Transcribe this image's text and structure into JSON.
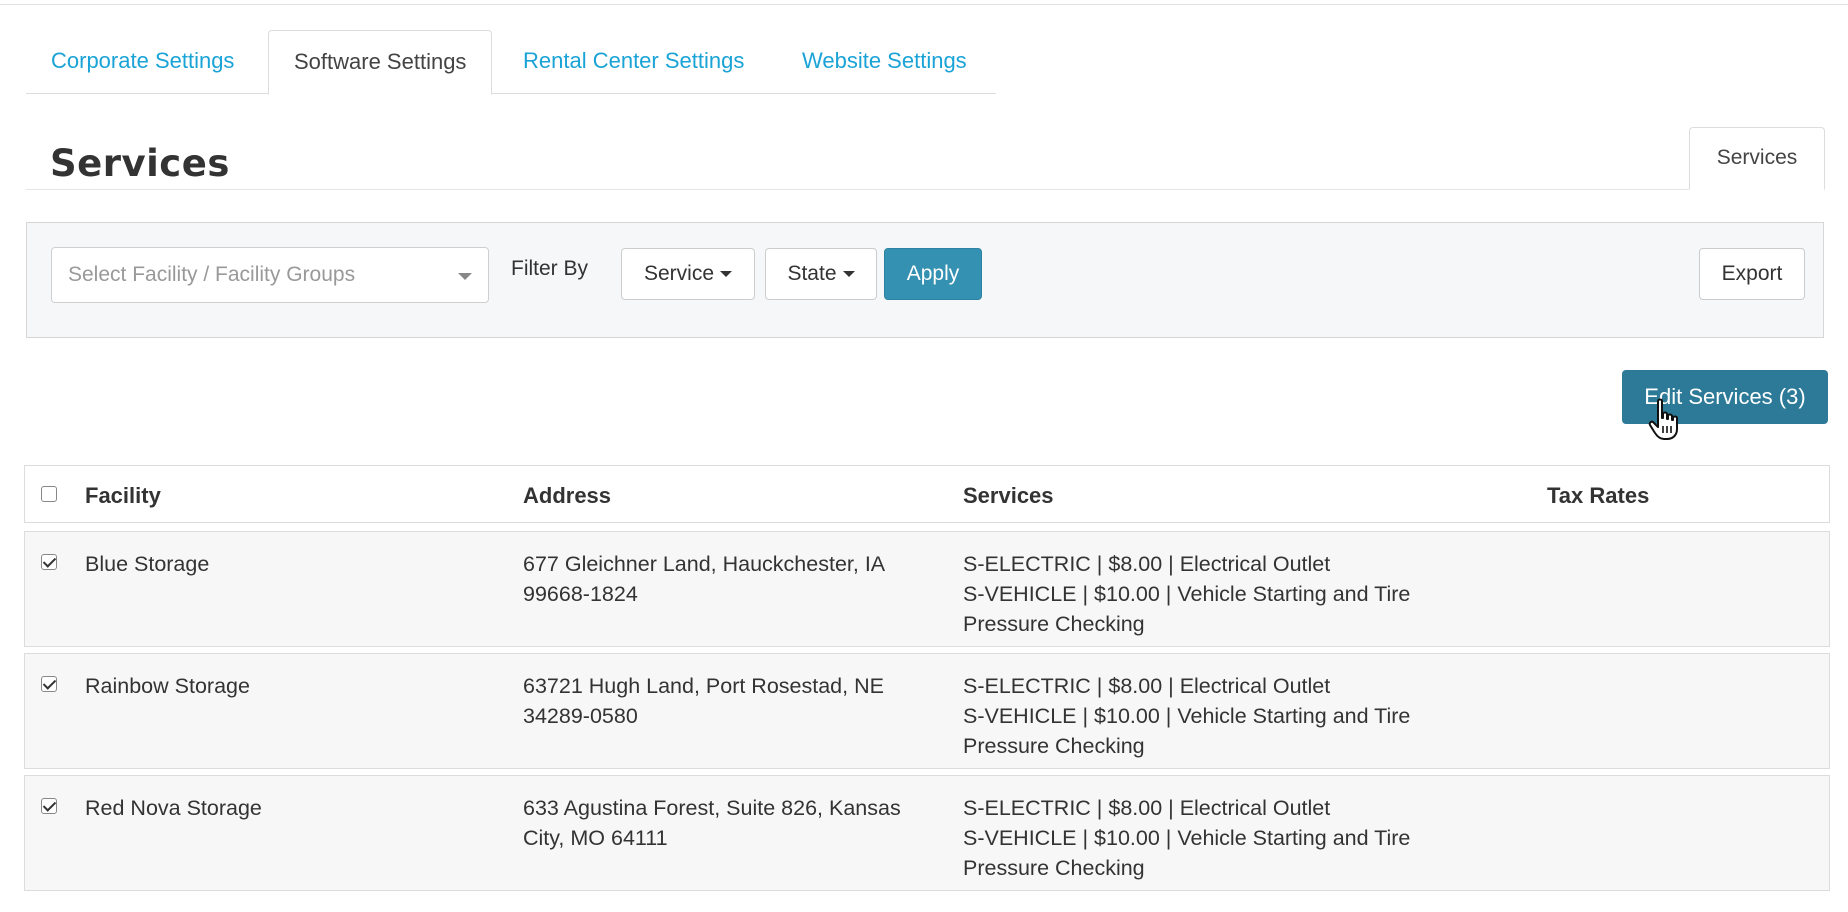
{
  "tabs": [
    {
      "label": "Corporate Settings",
      "active": false
    },
    {
      "label": "Software Settings",
      "active": true
    },
    {
      "label": "Rental Center Settings",
      "active": false
    },
    {
      "label": "Website Settings",
      "active": false
    }
  ],
  "section": {
    "title": "Services",
    "subtab_label": "Services"
  },
  "filters": {
    "facility_placeholder": "Select Facility / Facility Groups",
    "filter_by_label": "Filter By",
    "service_dropdown": "Service",
    "state_dropdown": "State",
    "apply_label": "Apply",
    "export_label": "Export"
  },
  "edit_services_label": "Edit Services (3)",
  "table": {
    "headers": {
      "facility": "Facility",
      "address": "Address",
      "services": "Services",
      "tax_rates": "Tax Rates"
    },
    "header_checked": false,
    "rows": [
      {
        "checked": true,
        "facility": "Blue Storage",
        "address_line1": "677 Gleichner Land, Hauckchester, IA",
        "address_line2": "99668-1824",
        "service_line1": "S-ELECTRIC | $8.00 | Electrical Outlet",
        "service_line2": "S-VEHICLE | $10.00 | Vehicle Starting and Tire",
        "service_line3": "Pressure Checking",
        "tax_rates": ""
      },
      {
        "checked": true,
        "facility": "Rainbow Storage",
        "address_line1": "63721 Hugh Land, Port Rosestad, NE",
        "address_line2": "34289-0580",
        "service_line1": "S-ELECTRIC | $8.00 | Electrical Outlet",
        "service_line2": "S-VEHICLE | $10.00 | Vehicle Starting and Tire",
        "service_line3": "Pressure Checking",
        "tax_rates": ""
      },
      {
        "checked": true,
        "facility": "Red Nova Storage",
        "address_line1": "633 Agustina Forest, Suite 826, Kansas",
        "address_line2": "City, MO 64111",
        "service_line1": "S-ELECTRIC | $8.00 | Electrical Outlet",
        "service_line2": "S-VEHICLE | $10.00 | Vehicle Starting and Tire",
        "service_line3": "Pressure Checking",
        "tax_rates": ""
      }
    ]
  },
  "colors": {
    "link": "#1aa3d6",
    "primary_button": "#3591b2",
    "edit_button": "#2c7a97",
    "panel_bg": "#f5f7f8"
  },
  "icons": {
    "cursor": "hand-pointer-icon"
  }
}
